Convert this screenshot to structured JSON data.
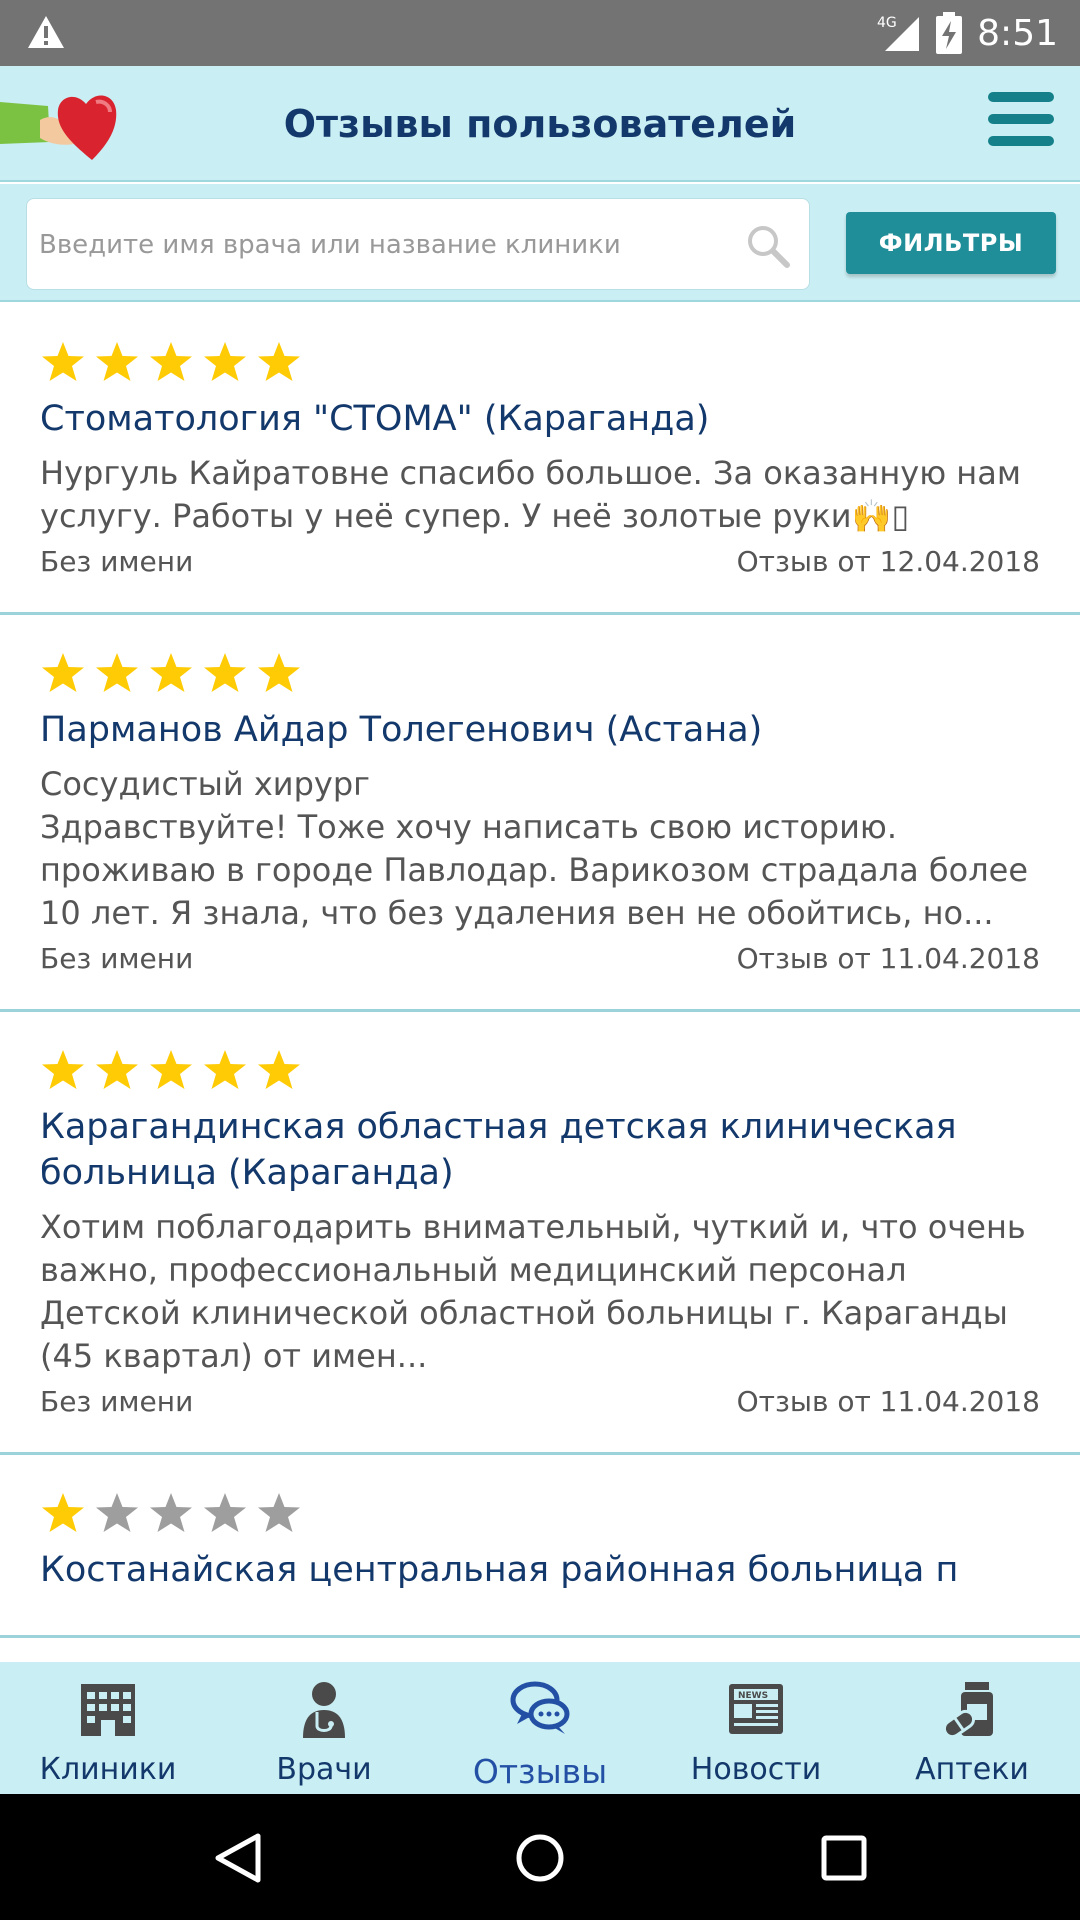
{
  "status_bar": {
    "network": "4G",
    "time": "8:51"
  },
  "app_bar": {
    "title": "Отзывы пользователей"
  },
  "search": {
    "placeholder": "Введите имя врача или название клиники",
    "value": ""
  },
  "filter_button": {
    "label": "ФИЛЬТРЫ"
  },
  "colors": {
    "accent": "#1f8e98",
    "title_blue": "#13386b",
    "star_gold": "#ffcb05",
    "star_gray": "#9e9e9e",
    "header_bg": "#c9eef3"
  },
  "reviews": [
    {
      "rating": 5,
      "title": "Стоматология \"СТОМА\" (Караганда)",
      "subtitle": "",
      "text": "Нургуль Кайратовне спасибо большое. За оказанную нам услугу. Работы у неё супер. У неё золотые руки🙌▯",
      "author": "Без имени",
      "date": "Отзыв от 12.04.2018"
    },
    {
      "rating": 5,
      "title": "Парманов Айдар Толегенович (Астана)",
      "subtitle": "Сосудистый хирург",
      "text": "Здравствуйте! Тоже хочу написать свою историю. проживаю в городе Павлодар. Варикозом страдала более 10 лет. Я знала, что без удаления вен не обойтись, но...",
      "author": "Без имени",
      "date": "Отзыв от 11.04.2018"
    },
    {
      "rating": 5,
      "title": "Карагандинская областная детская клиническая больница (Караганда)",
      "subtitle": "",
      "text": "Хотим поблагодарить внимательный, чуткий и, что очень важно, профессиональный медицинский персонал Детской клинической областной больницы г. Караганды (45 квартал) от имен...",
      "author": "Без имени",
      "date": "Отзыв от 11.04.2018"
    },
    {
      "rating": 1,
      "title": "Костанайская центральная районная больница п",
      "subtitle": "",
      "text": "",
      "author": "",
      "date": ""
    }
  ],
  "bottom_nav": [
    {
      "label": "Клиники",
      "icon": "hospital-icon",
      "active": false
    },
    {
      "label": "Врачи",
      "icon": "doctor-icon",
      "active": false
    },
    {
      "label": "Отзывы",
      "icon": "chat-bubbles-icon",
      "active": true
    },
    {
      "label": "Новости",
      "icon": "newspaper-icon",
      "active": false
    },
    {
      "label": "Аптеки",
      "icon": "pills-icon",
      "active": false
    }
  ]
}
